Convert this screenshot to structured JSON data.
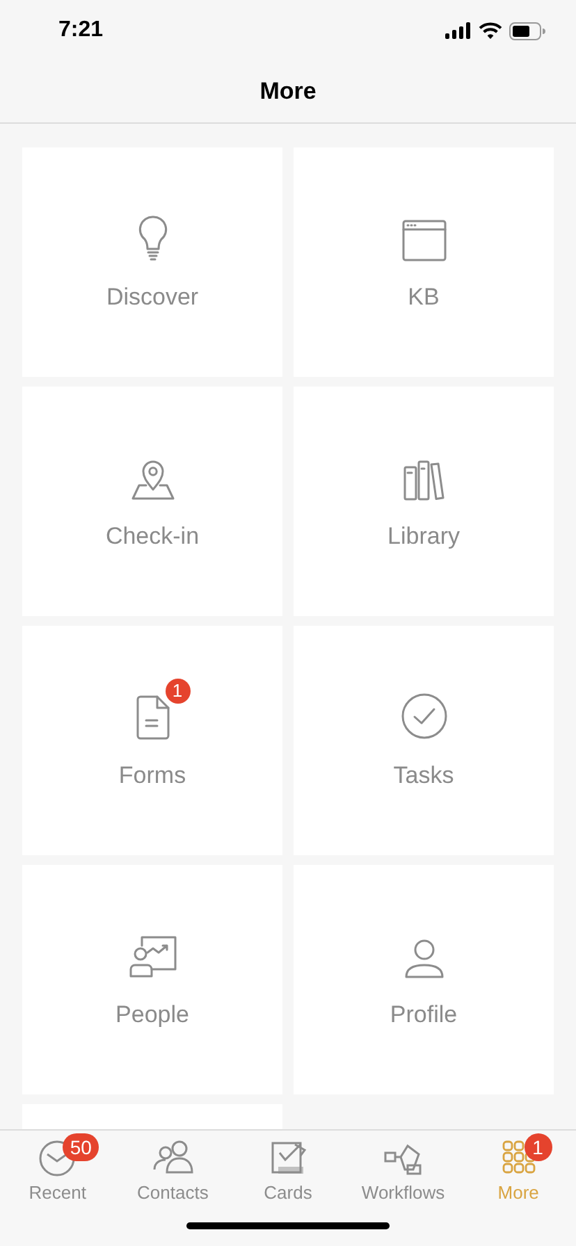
{
  "status_bar": {
    "time": "7:21"
  },
  "header": {
    "title": "More"
  },
  "tiles": [
    {
      "kind": "tile",
      "label": "Discover"
    },
    {
      "kind": "tile",
      "label": "KB"
    },
    {
      "kind": "tile",
      "label": "Check-in"
    },
    {
      "kind": "tile",
      "label": "Library"
    },
    {
      "kind": "tile",
      "label": "Forms",
      "badge": "1"
    },
    {
      "kind": "tile",
      "label": "Tasks"
    },
    {
      "kind": "tile",
      "label": "People"
    },
    {
      "kind": "tile",
      "label": "Profile"
    },
    {
      "kind": "cut"
    }
  ],
  "tab_bar": [
    {
      "label": "Recent",
      "selected": false,
      "badge": "50"
    },
    {
      "label": "Contacts",
      "selected": false
    },
    {
      "label": "Cards",
      "selected": false
    },
    {
      "label": "Workflows",
      "selected": false
    },
    {
      "label": "More",
      "selected": true,
      "badge": "1"
    }
  ]
}
